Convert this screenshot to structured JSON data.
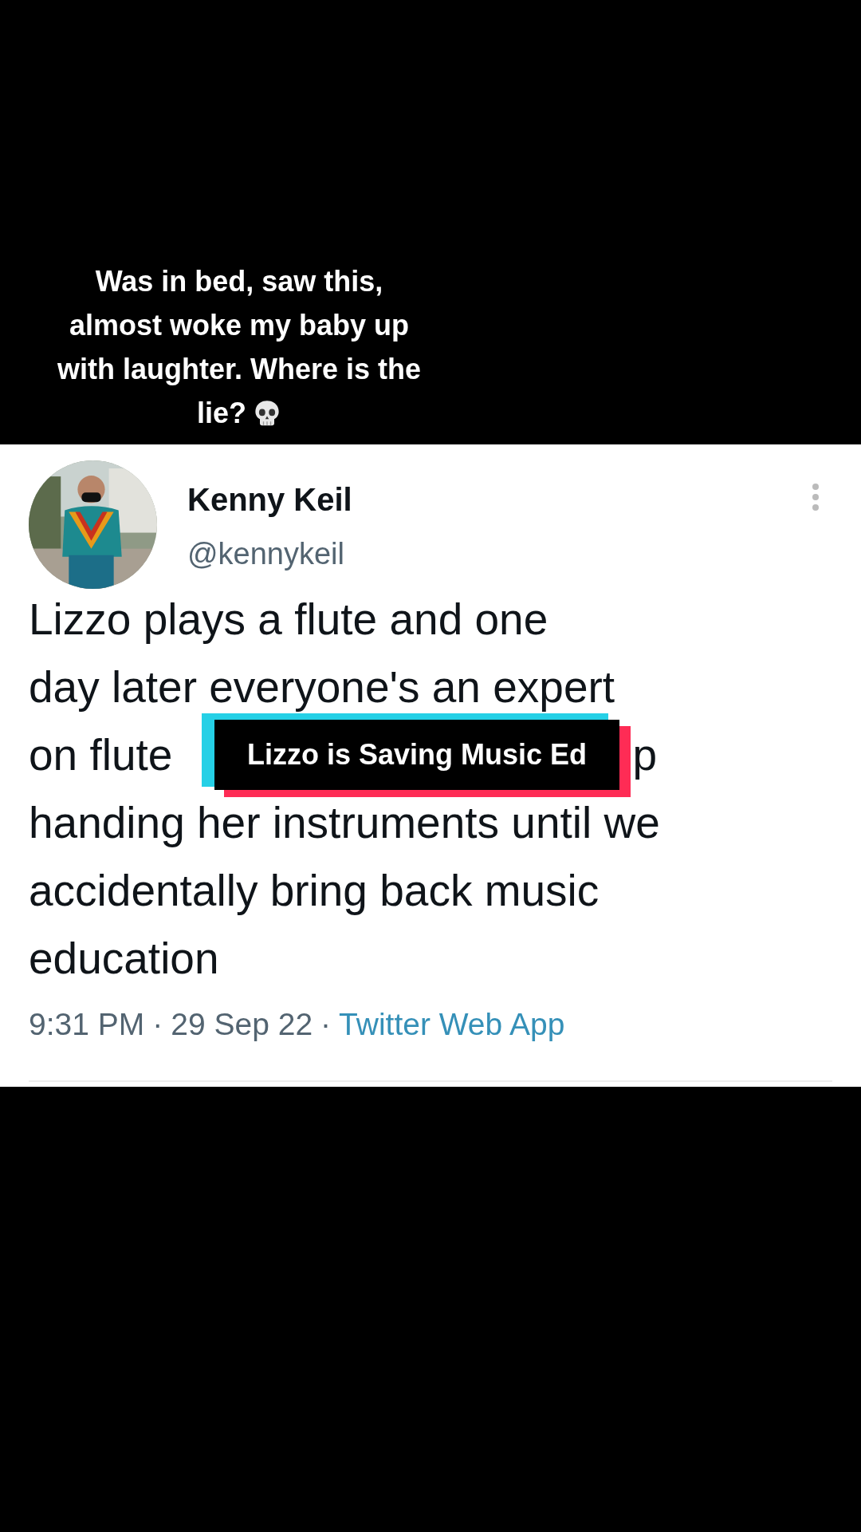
{
  "caption": {
    "lines": [
      "Was in bed, saw this,",
      "almost woke my baby up",
      "with laughter. Where is the",
      "lie?"
    ]
  },
  "tweet": {
    "name": "Kenny Keil",
    "handle": "@kennykeil",
    "lines": [
      {
        "parts": [
          "Lizzo plays a flute and one"
        ]
      },
      {
        "parts": [
          "day later everyone's an expert"
        ]
      },
      {
        "parts": [
          "on flute",
          "p"
        ]
      },
      {
        "parts": [
          "handing her instruments until we"
        ]
      },
      {
        "parts": [
          "accidentally bring back music"
        ]
      },
      {
        "parts": [
          "education"
        ]
      }
    ],
    "meta": [
      {
        "kind": "text",
        "text": "9:31 PM"
      },
      {
        "kind": "separator",
        "text": "·"
      },
      {
        "kind": "text",
        "text": "29 Sep 22"
      },
      {
        "kind": "separator",
        "text": "·"
      },
      {
        "kind": "link",
        "text": "Twitter Web App"
      }
    ]
  },
  "sticker": {
    "text": "Lizzo is Saving Music Ed"
  }
}
